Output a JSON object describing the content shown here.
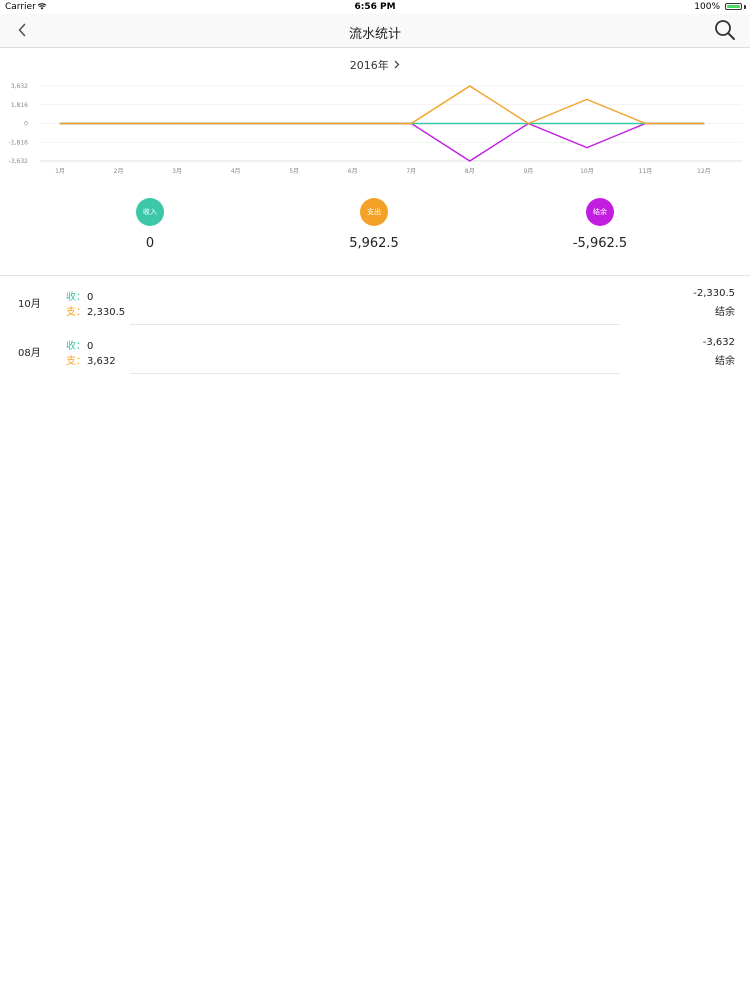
{
  "status": {
    "carrier": "Carrier",
    "time": "6:56 PM",
    "battery": "100%"
  },
  "nav": {
    "title": "流水统计"
  },
  "year_selector": {
    "label": "2016年"
  },
  "colors": {
    "income": "#3cc7a9",
    "expense": "#f4a227",
    "balance": "#c21ee0"
  },
  "chart_data": {
    "type": "line",
    "categories": [
      "1月",
      "2月",
      "3月",
      "4月",
      "5月",
      "6月",
      "7月",
      "8月",
      "9月",
      "10月",
      "11月",
      "12月"
    ],
    "y_ticks": [
      "3,632",
      "1,816",
      "0",
      "-1,816",
      "-3,632"
    ],
    "y_tick_values": [
      3632,
      1816,
      0,
      -1816,
      -3632
    ],
    "ylim": [
      -3632,
      3632
    ],
    "grid": true,
    "series": [
      {
        "name": "收入",
        "color": "#3cc7a9",
        "values": [
          0,
          0,
          0,
          0,
          0,
          0,
          0,
          0,
          0,
          0,
          0,
          0
        ]
      },
      {
        "name": "支出",
        "color": "#f4a227",
        "values": [
          0,
          0,
          0,
          0,
          0,
          0,
          0,
          3632,
          0,
          2330.5,
          0,
          0
        ]
      },
      {
        "name": "结余",
        "color": "#c21ee0",
        "values": [
          0,
          0,
          0,
          0,
          0,
          0,
          0,
          -3632,
          0,
          -2330.5,
          0,
          0
        ]
      }
    ]
  },
  "summary": {
    "income": {
      "label": "收入",
      "value": "0"
    },
    "expense": {
      "label": "支出",
      "value": "5,962.5"
    },
    "balance": {
      "label": "结余",
      "value": "-5,962.5"
    }
  },
  "rows": [
    {
      "month": "10月",
      "inc_label": "收：",
      "inc_value": "0",
      "exp_label": "支：",
      "exp_value": "2,330.5",
      "balance": "-2,330.5",
      "balance_label": "结余"
    },
    {
      "month": "08月",
      "inc_label": "收：",
      "inc_value": "0",
      "exp_label": "支：",
      "exp_value": "3,632",
      "balance": "-3,632",
      "balance_label": "结余"
    }
  ]
}
